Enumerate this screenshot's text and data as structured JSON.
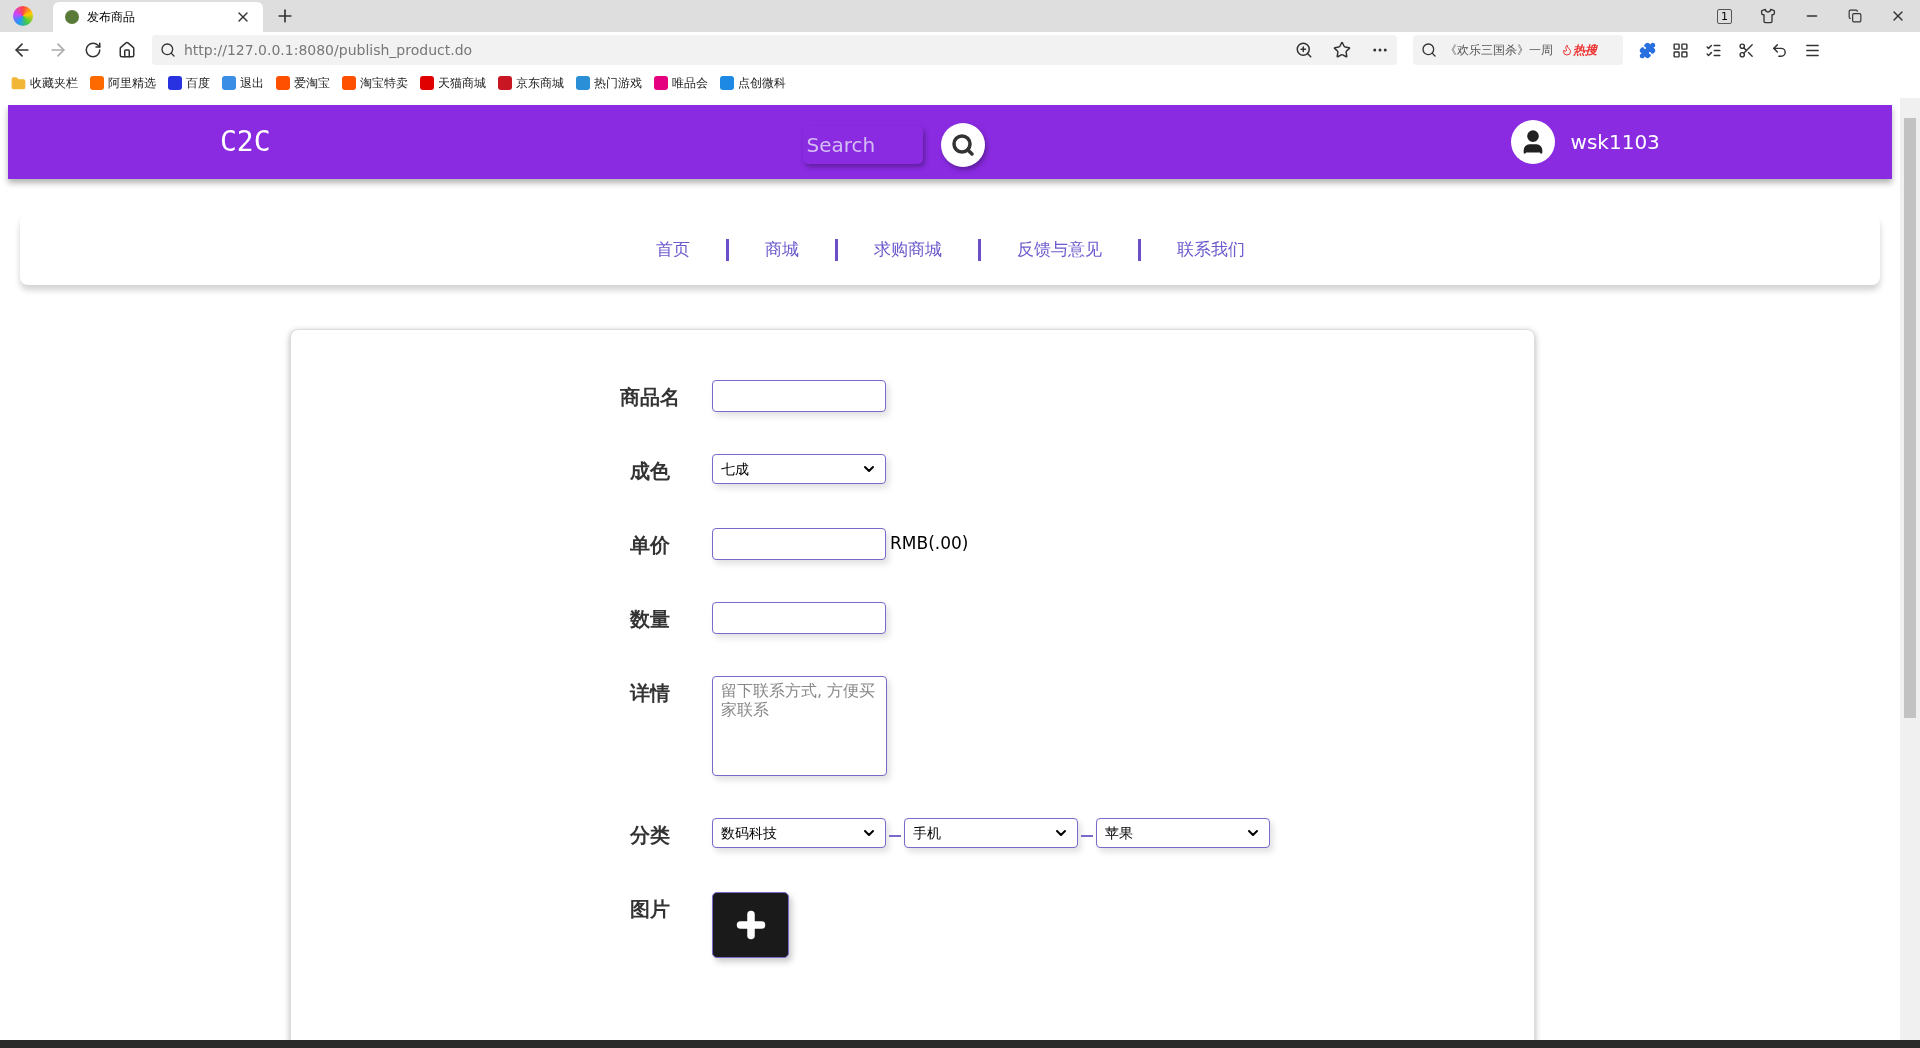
{
  "browser": {
    "tab_title": "发布商品",
    "url": "http://127.0.0.1:8080/publish_product.do",
    "tab_count": "1",
    "search_text": "《欢乐三国杀》一周",
    "hot_label": "热搜",
    "bookmarks": [
      {
        "label": "收藏夹栏",
        "color": "#f2b636"
      },
      {
        "label": "阿里精选",
        "color": "#ff6a00"
      },
      {
        "label": "百度",
        "color": "#2932e1"
      },
      {
        "label": "退出",
        "color": "#3a8ee6"
      },
      {
        "label": "爱淘宝",
        "color": "#ff5000"
      },
      {
        "label": "淘宝特卖",
        "color": "#ff5000"
      },
      {
        "label": "天猫商城",
        "color": "#e00000"
      },
      {
        "label": "京东商城",
        "color": "#c81623"
      },
      {
        "label": "热门游戏",
        "color": "#2a8fd6"
      },
      {
        "label": "唯品会",
        "color": "#e4007f"
      },
      {
        "label": "点创微科",
        "color": "#1e88e5"
      }
    ]
  },
  "header": {
    "logo": "C2C",
    "search_placeholder": "Search",
    "username": "wsk1103"
  },
  "nav": [
    "首页",
    "商城",
    "求购商城",
    "反馈与意见",
    "联系我们"
  ],
  "form": [
    {
      "kind": "text",
      "label": "商品名"
    },
    {
      "kind": "select",
      "label": "成色",
      "value": "七成"
    },
    {
      "kind": "text",
      "label": "单价",
      "suffix": "RMB(.00)"
    },
    {
      "kind": "text",
      "label": "数量"
    },
    {
      "kind": "textarea",
      "label": "详情",
      "placeholder": "留下联系方式, 方便买家联系"
    },
    {
      "kind": "category",
      "label": "分类",
      "values": [
        "数码科技",
        "手机",
        "苹果"
      ]
    },
    {
      "kind": "image",
      "label": "图片"
    }
  ]
}
